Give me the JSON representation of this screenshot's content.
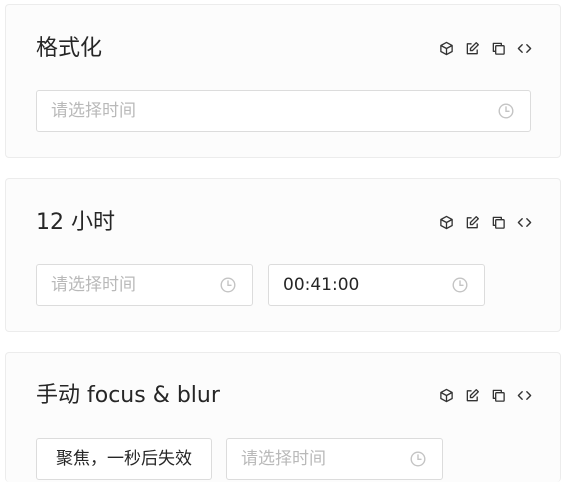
{
  "icons": {
    "cube": "cube-icon",
    "edit": "edit-icon",
    "copy": "copy-icon",
    "code": "code-icon",
    "clock": "clock-icon"
  },
  "colors": {
    "border": "#dcdcdc",
    "placeholder": "#b9b9b9",
    "text": "#262626"
  },
  "cards": [
    {
      "title": "格式化",
      "picker": {
        "placeholder": "请选择时间"
      }
    },
    {
      "title": "12 小时",
      "picker_a": {
        "placeholder": "请选择时间"
      },
      "picker_b": {
        "value": "00:41:00"
      }
    },
    {
      "title": "手动 focus & blur",
      "button": "聚焦，一秒后失效",
      "picker": {
        "placeholder": "请选择时间"
      }
    }
  ]
}
